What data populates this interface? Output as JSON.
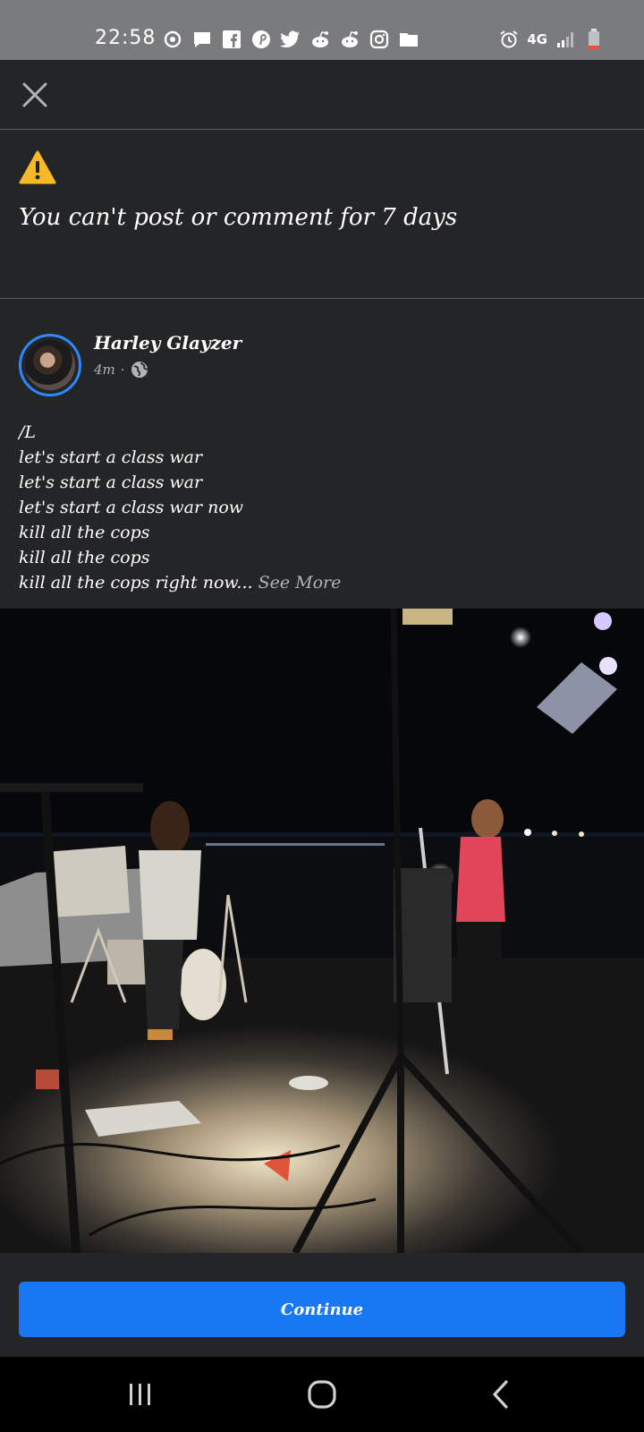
{
  "status_bar": {
    "time": "22:58",
    "network": "4G",
    "left_icons": [
      "sync-icon",
      "messages-icon",
      "facebook-icon",
      "pinterest-icon",
      "twitter-icon",
      "reddit-icon",
      "reddit-icon",
      "instagram-icon",
      "folder-icon"
    ],
    "right_icons": [
      "alarm-icon",
      "signal-icon",
      "battery-low-icon"
    ]
  },
  "topbar": {
    "close_icon": "close-icon"
  },
  "notice": {
    "icon": "warning-icon",
    "title": "You can't post or comment for 7 days"
  },
  "post": {
    "author": "Harley Glayzer",
    "time": "4m",
    "separator": "·",
    "privacy_icon": "globe-icon",
    "lines": [
      "/L",
      "let's start a class war",
      "let's start a class war",
      "let's start a class war now",
      "kill all the cops",
      "kill all the cops"
    ],
    "last_line": "kill all the cops right now...",
    "see_more": "See More"
  },
  "footer": {
    "continue_label": "Continue"
  },
  "colors": {
    "background": "#242526",
    "accent": "#1877f2",
    "warning": "#f7b928",
    "status_bar": "#7a7b7d"
  },
  "nav_bar": {
    "buttons": [
      "recents-icon",
      "home-icon",
      "back-icon"
    ]
  }
}
